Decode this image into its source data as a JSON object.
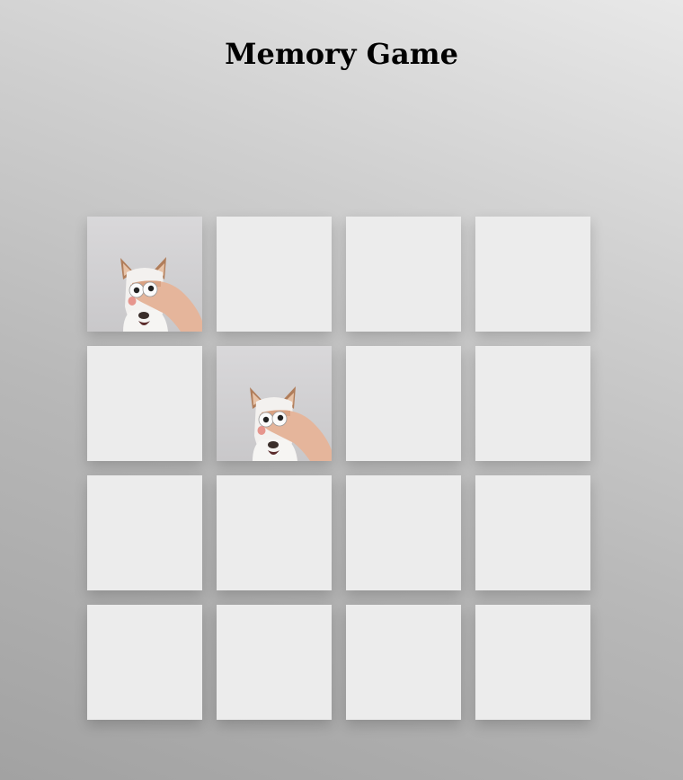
{
  "title": "Memory Game",
  "board": {
    "rows": 4,
    "columns": 4,
    "cards": [
      {
        "face_up": true,
        "image": "dog-with-googly-eyes"
      },
      {
        "face_up": false
      },
      {
        "face_up": false
      },
      {
        "face_up": false
      },
      {
        "face_up": false
      },
      {
        "face_up": true,
        "image": "dog-with-googly-eyes"
      },
      {
        "face_up": false
      },
      {
        "face_up": false
      },
      {
        "face_up": false
      },
      {
        "face_up": false
      },
      {
        "face_up": false
      },
      {
        "face_up": false
      },
      {
        "face_up": false
      },
      {
        "face_up": false
      },
      {
        "face_up": false
      },
      {
        "face_up": false
      }
    ]
  },
  "colors": {
    "card_back": "#ececec",
    "photo_background": "#d6d6d6"
  }
}
